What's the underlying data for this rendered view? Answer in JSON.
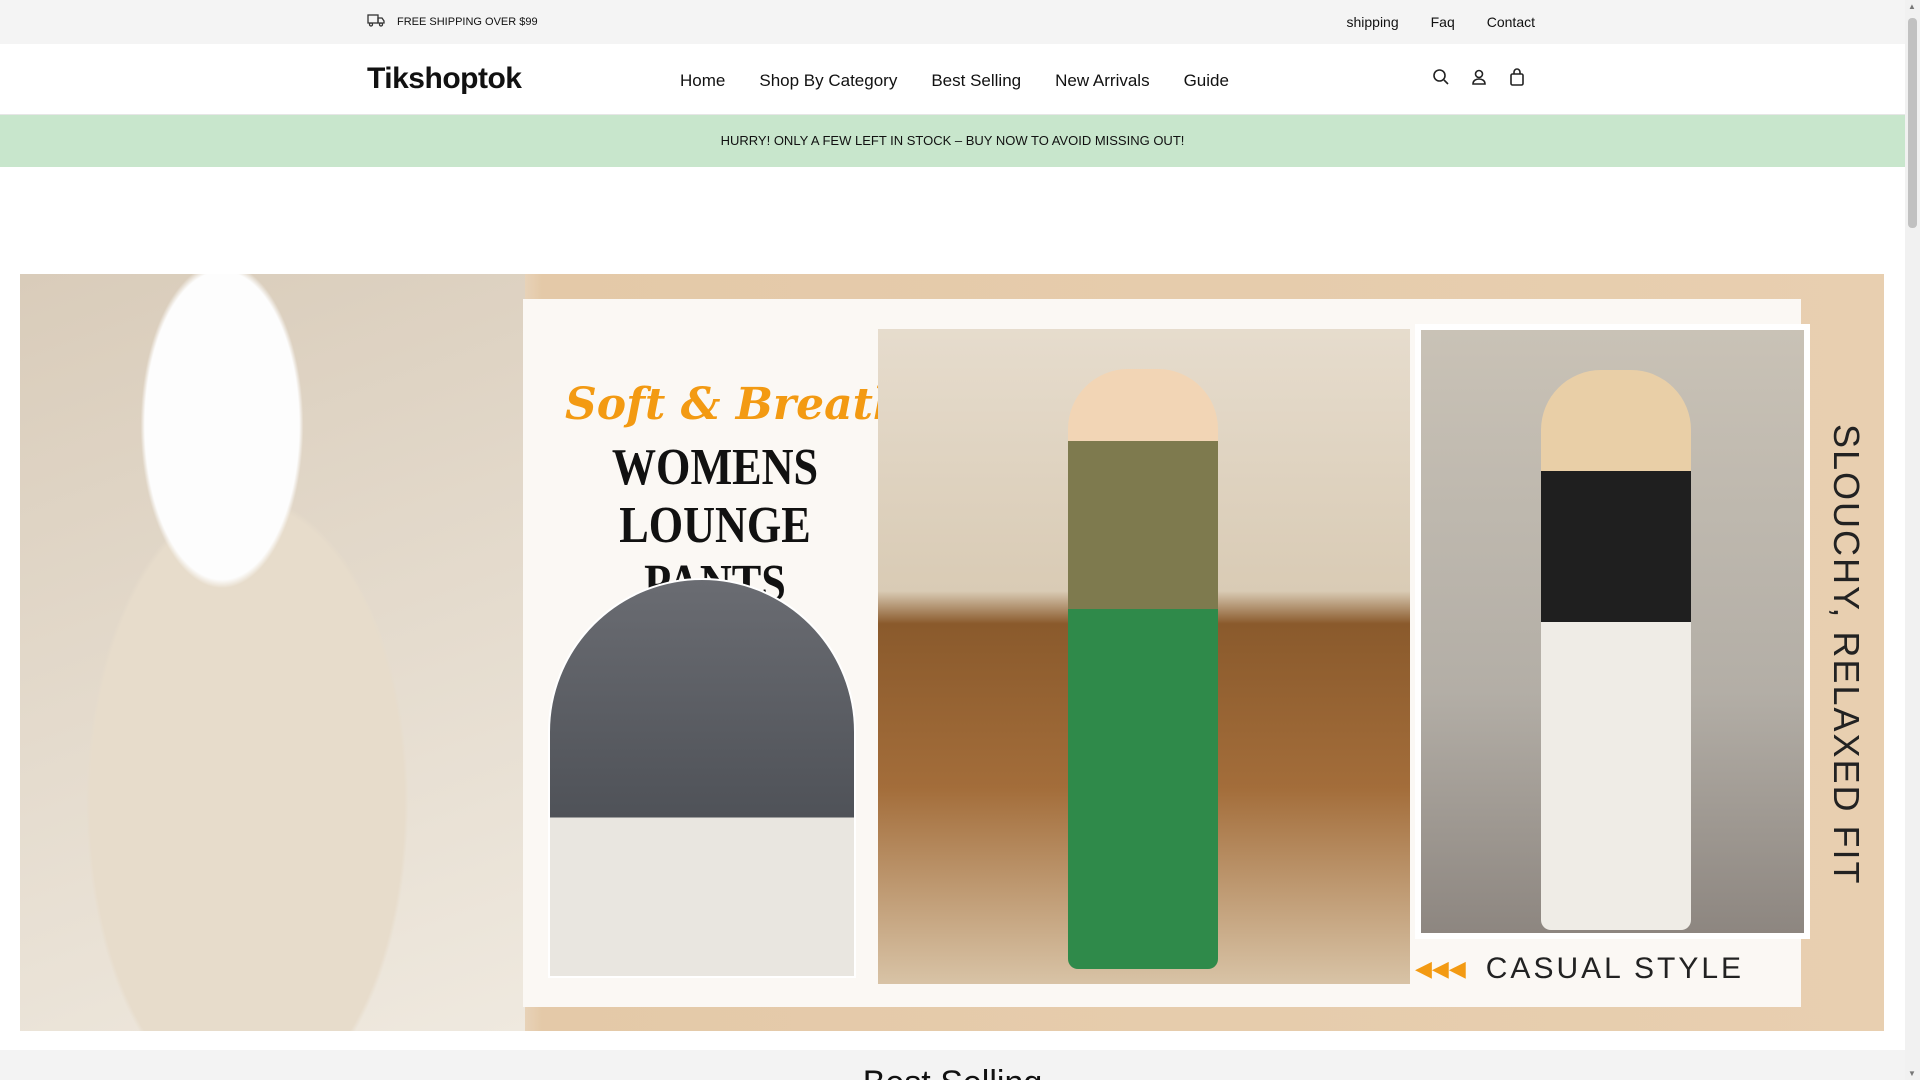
{
  "topbar": {
    "shipping_notice": "FREE SHIPPING OVER $99",
    "links": [
      "shipping",
      "Faq",
      "Contact"
    ]
  },
  "header": {
    "logo": "Tikshoptok",
    "nav": [
      "Home",
      "Shop By Category",
      "Best Selling",
      "New Arrivals",
      "Guide"
    ]
  },
  "promo": {
    "text": "HURRY! ONLY A FEW LEFT IN STOCK – BUY NOW TO AVOID MISSING OUT!"
  },
  "banner": {
    "tagline": "Soft & Breathable",
    "title_line1": "WOMENS",
    "title_line2": "LOUNGE PANTS",
    "vertical_text": "SLOUCHY, RELAXED FIT",
    "arrows": "◀◀◀",
    "style_label": "CASUAL STYLE"
  },
  "section": {
    "title": "Best Selling"
  }
}
